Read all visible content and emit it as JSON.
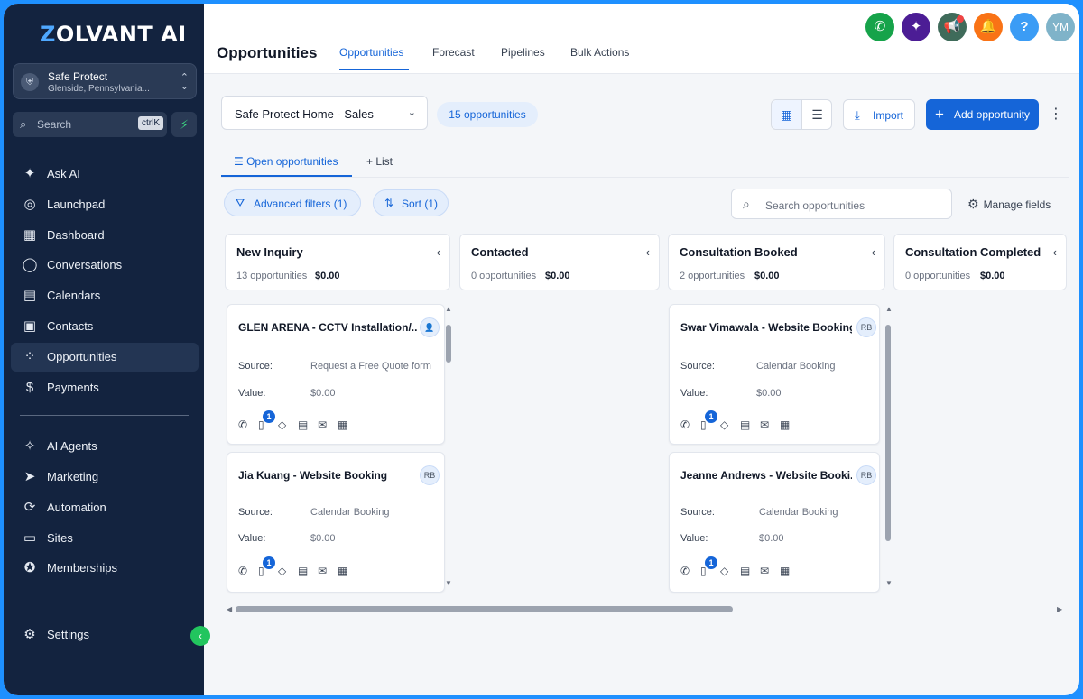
{
  "brand": {
    "logo_prefix": "Z",
    "logo_rest": "OLVANT AI"
  },
  "account": {
    "name": "Safe Protect",
    "location": "Glenside, Pennsylvania..."
  },
  "sidebar": {
    "search_placeholder": "Search",
    "search_shortcut": "ctrlK",
    "items": [
      {
        "label": "Ask AI",
        "icon": "sparkle-icon"
      },
      {
        "label": "Launchpad",
        "icon": "rocket-icon"
      },
      {
        "label": "Dashboard",
        "icon": "grid-icon"
      },
      {
        "label": "Conversations",
        "icon": "chat-icon"
      },
      {
        "label": "Calendars",
        "icon": "calendar-icon"
      },
      {
        "label": "Contacts",
        "icon": "contact-card-icon"
      },
      {
        "label": "Opportunities",
        "icon": "network-icon"
      },
      {
        "label": "Payments",
        "icon": "dollar-icon"
      },
      {
        "label": "AI Agents",
        "icon": "ai-sparkle-icon"
      },
      {
        "label": "Marketing",
        "icon": "send-icon"
      },
      {
        "label": "Automation",
        "icon": "automation-icon"
      },
      {
        "label": "Sites",
        "icon": "browser-icon"
      },
      {
        "label": "Memberships",
        "icon": "badge-icon"
      },
      {
        "label": "Settings",
        "icon": "gear-icon"
      }
    ],
    "active_item": "Opportunities"
  },
  "header": {
    "title": "Opportunities",
    "tabs": [
      "Opportunities",
      "Forecast",
      "Pipelines",
      "Bulk Actions"
    ],
    "active_tab": "Opportunities",
    "avatar_initials": "YM"
  },
  "toolbar": {
    "pipeline": "Safe Protect Home - Sales",
    "count_badge": "15 opportunities",
    "import_label": "Import",
    "add_label": "Add opportunity"
  },
  "subtabs": {
    "open": "Open opportunities",
    "list": "List"
  },
  "filters": {
    "advanced": "Advanced filters (1)",
    "sort": "Sort (1)",
    "search_placeholder": "Search opportunities",
    "manage": "Manage fields"
  },
  "columns": [
    {
      "name": "New Inquiry",
      "count": "13 opportunities",
      "amount": "$0.00",
      "cards": [
        {
          "title": "GLEN ARENA - CCTV Installation/...",
          "avatar": "",
          "source_label": "Source:",
          "source": "Request a Free Quote form",
          "value_label": "Value:",
          "value": "$0.00",
          "badge": "1"
        },
        {
          "title": "Jia Kuang - Website Booking",
          "avatar": "RB",
          "source_label": "Source:",
          "source": "Calendar Booking",
          "value_label": "Value:",
          "value": "$0.00",
          "badge": "1"
        }
      ]
    },
    {
      "name": "Contacted",
      "count": "0 opportunities",
      "amount": "$0.00",
      "cards": []
    },
    {
      "name": "Consultation Booked",
      "count": "2 opportunities",
      "amount": "$0.00",
      "cards": [
        {
          "title": "Swar Vimawala - Website Booking",
          "avatar": "RB",
          "source_label": "Source:",
          "source": "Calendar Booking",
          "value_label": "Value:",
          "value": "$0.00",
          "badge": "1"
        },
        {
          "title": "Jeanne Andrews - Website Booki...",
          "avatar": "RB",
          "source_label": "Source:",
          "source": "Calendar Booking",
          "value_label": "Value:",
          "value": "$0.00",
          "badge": "1"
        }
      ]
    },
    {
      "name": "Consultation Completed",
      "count": "0 opportunities",
      "amount": "$0.00",
      "cards": []
    }
  ],
  "colors": {
    "sidebar_bg": "#13233f",
    "accent": "#1565d8",
    "frame_border": "#1e90ff"
  }
}
